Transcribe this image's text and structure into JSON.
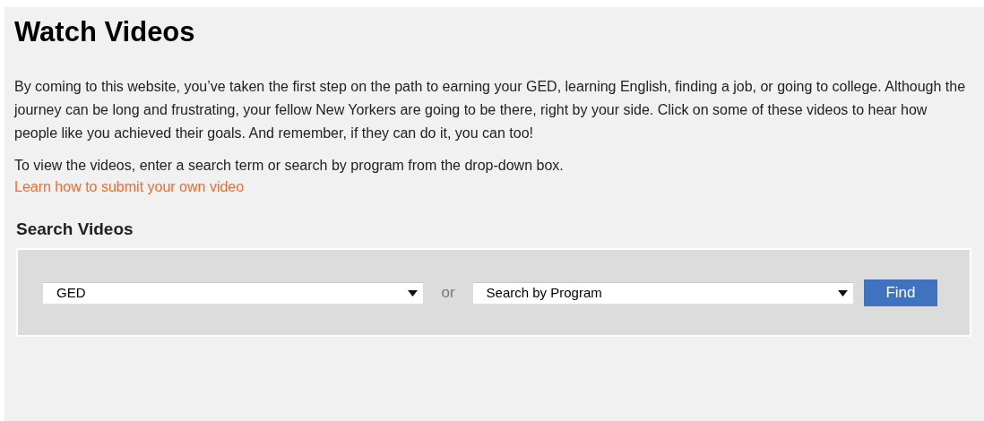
{
  "title": "Watch Videos",
  "intro": "By coming to this website, you’ve taken the first step on the path to earning your GED, learning English, finding a job, or going to college. Although the journey can be long and frustrating, your fellow New Yorkers are going to be there, right by your side. Click on some of these videos to hear how people like you achieved their goals. And remember, if they can do it, you can too!",
  "instructions": "To view the videos, enter a search term or search by program from the drop-down box.",
  "submit_link": "Learn how to submit your own video",
  "search": {
    "heading": "Search Videos",
    "term_select": {
      "value": "GED"
    },
    "separator": "or",
    "program_select": {
      "value": "Search by Program"
    },
    "find_button": "Find"
  }
}
